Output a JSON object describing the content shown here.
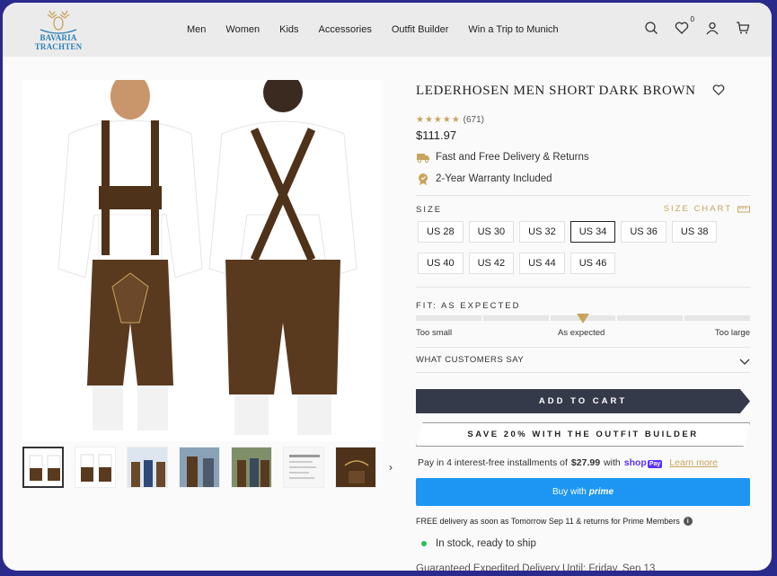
{
  "header": {
    "logo_text": "BAVARIA TRACHTEN",
    "nav": [
      "Men",
      "Women",
      "Kids",
      "Accessories",
      "Outfit Builder",
      "Win a Trip to Munich"
    ],
    "wishlist_count": "0"
  },
  "product": {
    "title": "LEDERHOSEN MEN SHORT DARK BROWN",
    "stars": "★★★★★",
    "review_count": "(671)",
    "price": "$111.97",
    "perks": [
      "Fast and Free Delivery & Returns",
      "2-Year Warranty Included"
    ]
  },
  "size": {
    "label": "SIZE",
    "chart_label": "SIZE CHART",
    "row1": [
      "US 28",
      "US 30",
      "US 32",
      "US 34",
      "US 36",
      "US 38"
    ],
    "row2": [
      "US 40",
      "US 42",
      "US 44",
      "US 46"
    ],
    "selected": "US 34"
  },
  "fit": {
    "label": "FIT: AS EXPECTED",
    "low": "Too small",
    "mid": "As expected",
    "high": "Too large",
    "position": 0.5
  },
  "customers_say": "WHAT CUSTOMERS SAY",
  "buttons": {
    "add_to_cart": "ADD TO CART",
    "outfit": "SAVE 20% WITH THE OUTFIT BUILDER",
    "prime_prefix": "Buy with",
    "prime_word": "prime"
  },
  "installments": {
    "prefix": "Pay in 4 interest-free installments of",
    "amount": "$27.99",
    "with": "with",
    "shop": "shop",
    "pay": "Pay",
    "learn_more": "Learn more"
  },
  "delivery": "FREE delivery as soon as Tomorrow Sep 11 & returns for Prime Members",
  "stock": "In stock, ready to ship",
  "guaranteed": "Guaranteed Expedited Delivery Until: Friday, Sep 13",
  "thumbs": [
    "front",
    "back",
    "authentic",
    "outdoor",
    "group",
    "size",
    "detail"
  ],
  "colors": {
    "accent": "#c9a45c",
    "cart_button": "#353a4b",
    "prime_button": "#1d96f3",
    "leather": "#5a3a1f",
    "in_stock": "#2ebd59"
  }
}
